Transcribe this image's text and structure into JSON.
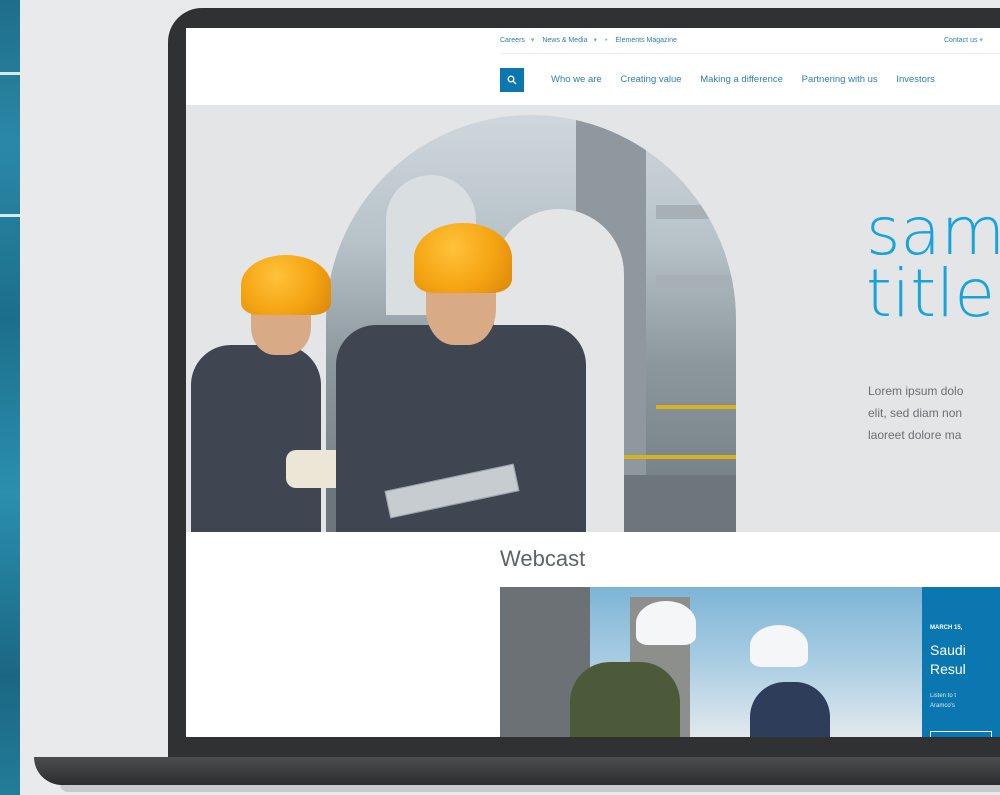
{
  "utility_nav": {
    "items": [
      "Careers",
      "News & Media",
      "Elements Magazine"
    ],
    "contact": "Contact us"
  },
  "main_nav": {
    "items": [
      "Who we are",
      "Creating value",
      "Making a difference",
      "Partnering with us",
      "Investors"
    ]
  },
  "hero": {
    "title_line1": "sam",
    "title_line2": "title",
    "body_line1": "Lorem ipsum dolo",
    "body_line2": "elit, sed diam non",
    "body_line3": "laoreet dolore ma"
  },
  "webcast": {
    "heading": "Webcast",
    "date": "MARCH 15,",
    "title_line1": "Saudi",
    "title_line2": "Resul",
    "desc_line1": "Listen to t",
    "desc_line2": "Aramco's"
  },
  "colors": {
    "brand_blue": "#0a77b0",
    "title_blue": "#19a3dc",
    "helmet_orange": "#f5a412"
  },
  "icons": {
    "search": "search-icon"
  }
}
